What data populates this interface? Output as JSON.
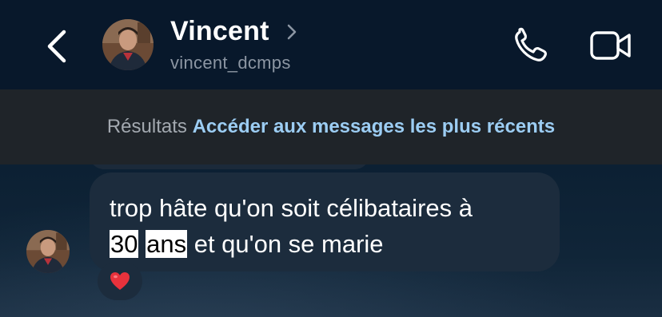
{
  "header": {
    "contact_name": "Vincent",
    "username": "vincent_dcmps",
    "icons": [
      "back-chevron-icon",
      "chevron-right-icon",
      "phone-icon",
      "video-camera-icon"
    ]
  },
  "banner": {
    "prefix": "Résultats",
    "link_text": "Accéder aux messages les plus récents"
  },
  "message": {
    "text_part1": "trop hâte qu'on soit célibataires à",
    "highlight1": "30",
    "highlight2": "ans",
    "text_part2": "et qu'on se marie",
    "reaction": "heart-icon"
  },
  "colors": {
    "header_bg": "#08182b",
    "banner_bg": "#1f2429",
    "link": "#9ccdf3",
    "bubble": "#1c2c3d",
    "heart": "#e8323c"
  }
}
